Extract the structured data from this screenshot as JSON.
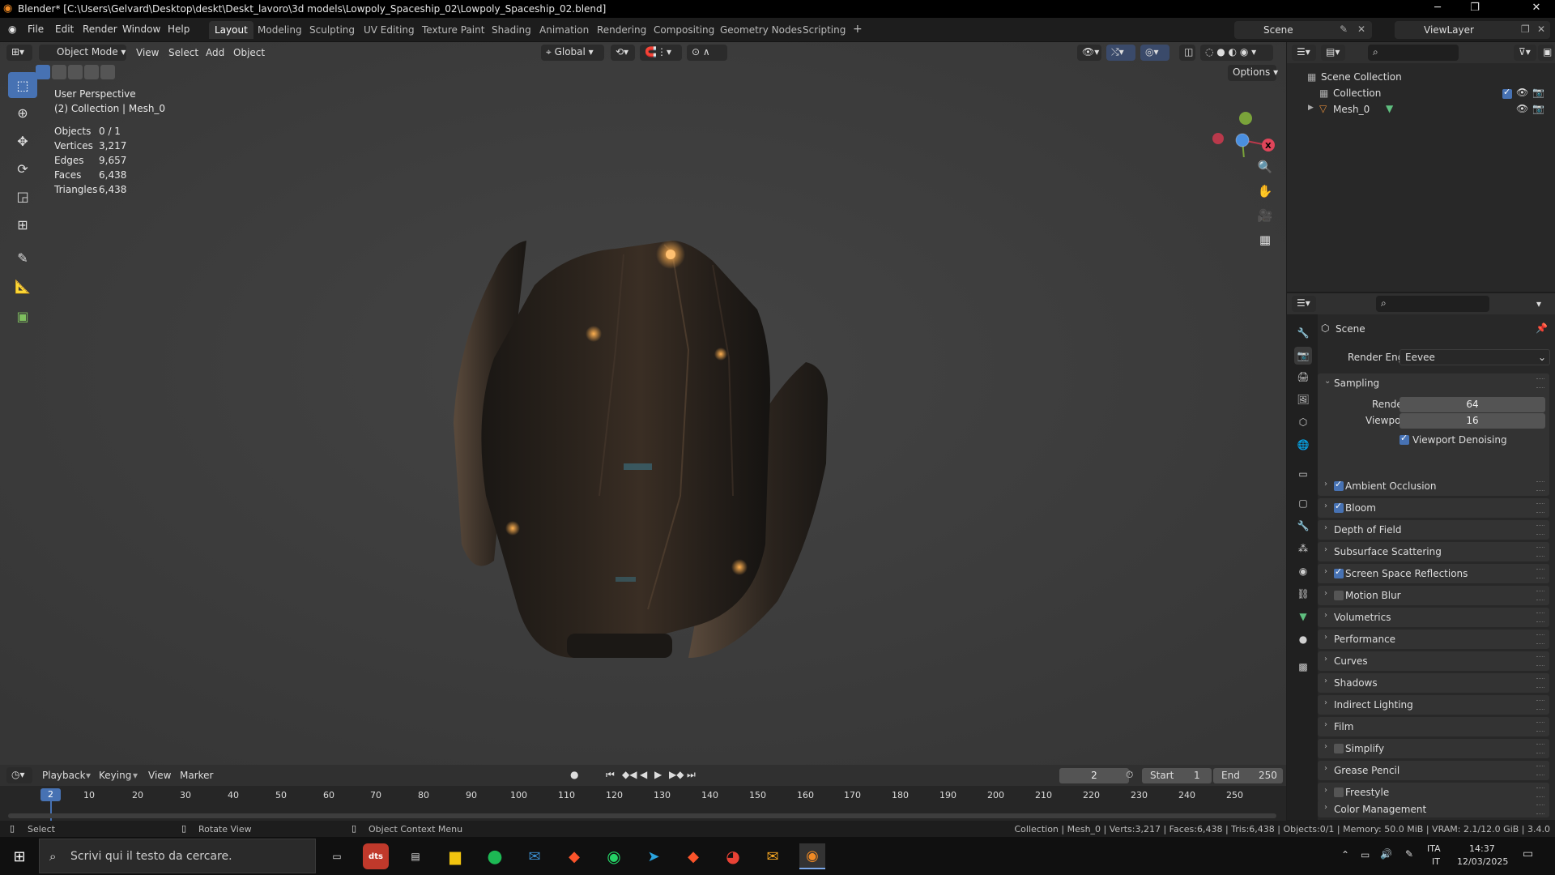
{
  "window": {
    "title": "Blender* [C:\\Users\\Gelvard\\Desktop\\deskt\\Deskt_lavoro\\3d models\\Lowpoly_Spaceship_02\\Lowpoly_Spaceship_02.blend]"
  },
  "menu": [
    "File",
    "Edit",
    "Render",
    "Window",
    "Help"
  ],
  "workspaces": [
    "Layout",
    "Modeling",
    "Sculpting",
    "UV Editing",
    "Texture Paint",
    "Shading",
    "Animation",
    "Rendering",
    "Compositing",
    "Geometry Nodes",
    "Scripting"
  ],
  "topright": {
    "scene": "Scene",
    "view_layer": "ViewLayer"
  },
  "viewport_header": {
    "mode": "Object Mode",
    "menus": [
      "View",
      "Select",
      "Add",
      "Object"
    ],
    "orientation": "Global",
    "options": "Options"
  },
  "overlay": {
    "perspective": "User Perspective",
    "collection": "(2) Collection | Mesh_0",
    "stats": [
      {
        "label": "Objects",
        "value": "0 / 1"
      },
      {
        "label": "Vertices",
        "value": "3,217"
      },
      {
        "label": "Edges",
        "value": "9,657"
      },
      {
        "label": "Faces",
        "value": "6,438"
      },
      {
        "label": "Triangles",
        "value": "6,438"
      }
    ]
  },
  "gizmo": {
    "x": "X",
    "y": "Y",
    "z": "Z"
  },
  "outliner": {
    "scene_collection": "Scene Collection",
    "collection": "Collection",
    "mesh": "Mesh_0"
  },
  "properties": {
    "context": "Scene",
    "render_engine_label": "Render Engine",
    "render_engine": "Eevee",
    "sampling": "Sampling",
    "render_label": "Render",
    "render_value": "64",
    "viewport_label": "Viewport",
    "viewport_value": "16",
    "viewport_denoising": "Viewport Denoising",
    "panels": [
      {
        "label": "Ambient Occlusion",
        "checkbox": true,
        "checked": true
      },
      {
        "label": "Bloom",
        "checkbox": true,
        "checked": true
      },
      {
        "label": "Depth of Field",
        "checkbox": false,
        "checked": false
      },
      {
        "label": "Subsurface Scattering",
        "checkbox": false,
        "checked": false
      },
      {
        "label": "Screen Space Reflections",
        "checkbox": true,
        "checked": true
      },
      {
        "label": "Motion Blur",
        "checkbox": true,
        "checked": false
      },
      {
        "label": "Volumetrics",
        "checkbox": false,
        "checked": false
      },
      {
        "label": "Performance",
        "checkbox": false,
        "checked": false
      },
      {
        "label": "Curves",
        "checkbox": false,
        "checked": false
      },
      {
        "label": "Shadows",
        "checkbox": false,
        "checked": false
      },
      {
        "label": "Indirect Lighting",
        "checkbox": false,
        "checked": false
      },
      {
        "label": "Film",
        "checkbox": false,
        "checked": false
      },
      {
        "label": "Simplify",
        "checkbox": true,
        "checked": false
      },
      {
        "label": "Grease Pencil",
        "checkbox": false,
        "checked": false
      },
      {
        "label": "Freestyle",
        "checkbox": true,
        "checked": false
      },
      {
        "label": "Color Management",
        "checkbox": false,
        "checked": false
      }
    ]
  },
  "timeline": {
    "menus": [
      "Playback",
      "Keying",
      "View",
      "Marker"
    ],
    "current_frame": "2",
    "start_label": "Start",
    "start": "1",
    "end_label": "End",
    "end": "250",
    "ruler": [
      "2",
      "10",
      "20",
      "30",
      "40",
      "50",
      "60",
      "70",
      "80",
      "90",
      "100",
      "110",
      "120",
      "130",
      "140",
      "150",
      "160",
      "170",
      "180",
      "190",
      "200",
      "210",
      "220",
      "230",
      "240",
      "250"
    ]
  },
  "status": {
    "select": "Select",
    "rotate": "Rotate View",
    "context_menu": "Object Context Menu",
    "info": "Collection | Mesh_0 | Verts:3,217 | Faces:6,438 | Tris:6,438 | Objects:0/1 | Memory: 50.0 MiB | VRAM: 2.1/12.0 GiB | 3.4.0"
  },
  "taskbar": {
    "search_placeholder": "Scrivi qui il testo da cercare.",
    "lang1": "ITA",
    "lang2": "IT",
    "time": "14:37",
    "date": "12/03/2025"
  },
  "colors": {
    "accent": "#4772b3",
    "x_axis": "#e0455a",
    "y_axis": "#8bc34a",
    "z_axis": "#4a8fe0"
  }
}
